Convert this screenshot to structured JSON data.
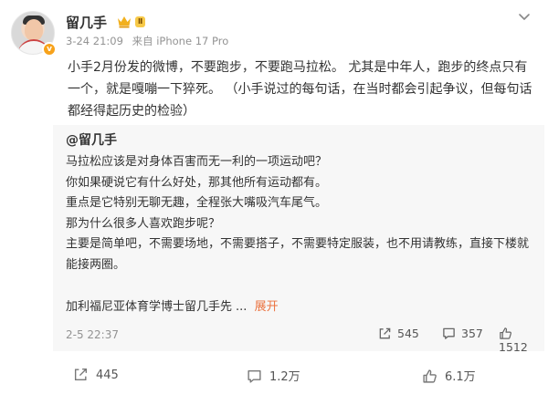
{
  "author": {
    "name": "留几手",
    "vip_label": "Ⅱ",
    "verified_label": "v",
    "time": "3-24 21:09",
    "source": "来自 iPhone 17 Pro"
  },
  "post": {
    "text": "小手2月份发的微博，不要跑步，不要跑马拉松。 尤其是中年人，跑步的终点只有一个，就是嘎嘣一下猝死。",
    "aside": "（小手说过的每句话，在当时都会引起争议，但每句话都经得起历史的检验）"
  },
  "repost": {
    "author": "@留几手",
    "lines": [
      "马拉松应该是对身体百害而无一利的一项运动吧？",
      "你如果硬说它有什么好处，那其他所有运动都有。",
      "重点是它特别无聊无趣，全程张大嘴吸汽车尾气。",
      "那为什么很多人喜欢跑步呢？",
      "主要是简单吧，不需要场地，不需要搭子，不需要特定服装，也不用请教练，直接下楼就能接两圈。"
    ],
    "signature": "加利福尼亚体育学博士留几手先",
    "ellipsis": "...",
    "expand_label": "展开",
    "date": "2-5 22:37",
    "reposts": "545",
    "comments": "357",
    "likes": "1512"
  },
  "actions": {
    "reposts": "445",
    "comments": "1.2万",
    "likes": "6.1万"
  },
  "colors": {
    "accent": "#eb7340",
    "repost_bg": "#f7f7f7",
    "meta_gray": "#939393"
  }
}
